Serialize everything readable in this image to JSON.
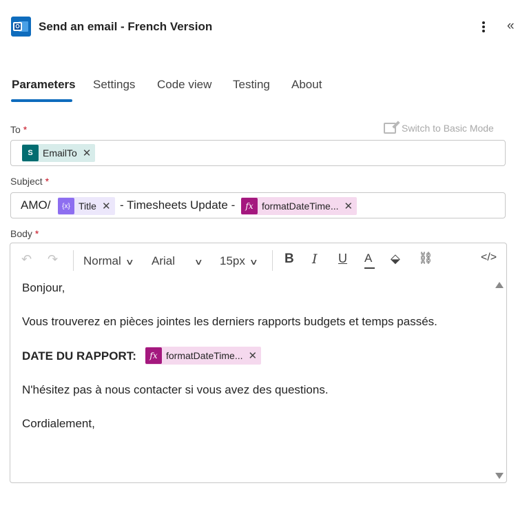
{
  "header": {
    "title": "Send an email - French Version",
    "app_icon": "outlook-icon",
    "more_icon": "more-vertical-icon",
    "collapse_icon": "double-chevron-left-icon"
  },
  "tabs": [
    {
      "label": "Parameters",
      "active": true
    },
    {
      "label": "Settings",
      "active": false
    },
    {
      "label": "Code view",
      "active": false
    },
    {
      "label": "Testing",
      "active": false
    },
    {
      "label": "About",
      "active": false
    }
  ],
  "fields": {
    "to": {
      "label": "To",
      "required_mark": "*",
      "switch_mode_label": "Switch to Basic Mode",
      "tokens": [
        {
          "label": "EmailTo",
          "icon": "sharepoint-icon"
        }
      ]
    },
    "subject": {
      "label": "Subject",
      "required_mark": "*",
      "prefix": "AMO/",
      "token1": {
        "label": "Title",
        "icon": "variable-icon",
        "glyph": "{x}"
      },
      "middle": "- Timesheets Update -",
      "token2": {
        "label": "formatDateTime...",
        "icon": "function-icon",
        "glyph": "fx"
      }
    },
    "body": {
      "label": "Body",
      "required_mark": "*",
      "toolbar": {
        "style": "Normal",
        "font": "Arial",
        "size": "15px"
      },
      "lines": {
        "greeting": "Bonjour,",
        "intro": "Vous trouverez en pièces jointes les derniers rapports budgets et temps passés.",
        "date_label": "DATE DU RAPPORT:",
        "date_token": {
          "label": "formatDateTime...",
          "glyph": "fx"
        },
        "contact": "N'hésitez pas à nous contacter si vous avez des questions.",
        "closing": "Cordialement,"
      }
    }
  },
  "colors": {
    "accent": "#0f6cbd",
    "required": "#c50f1f",
    "sharepoint_token_bg": "#d7ecea",
    "variable_token_bg": "#ece7fb",
    "function_token_bg": "#f5d9ee"
  }
}
